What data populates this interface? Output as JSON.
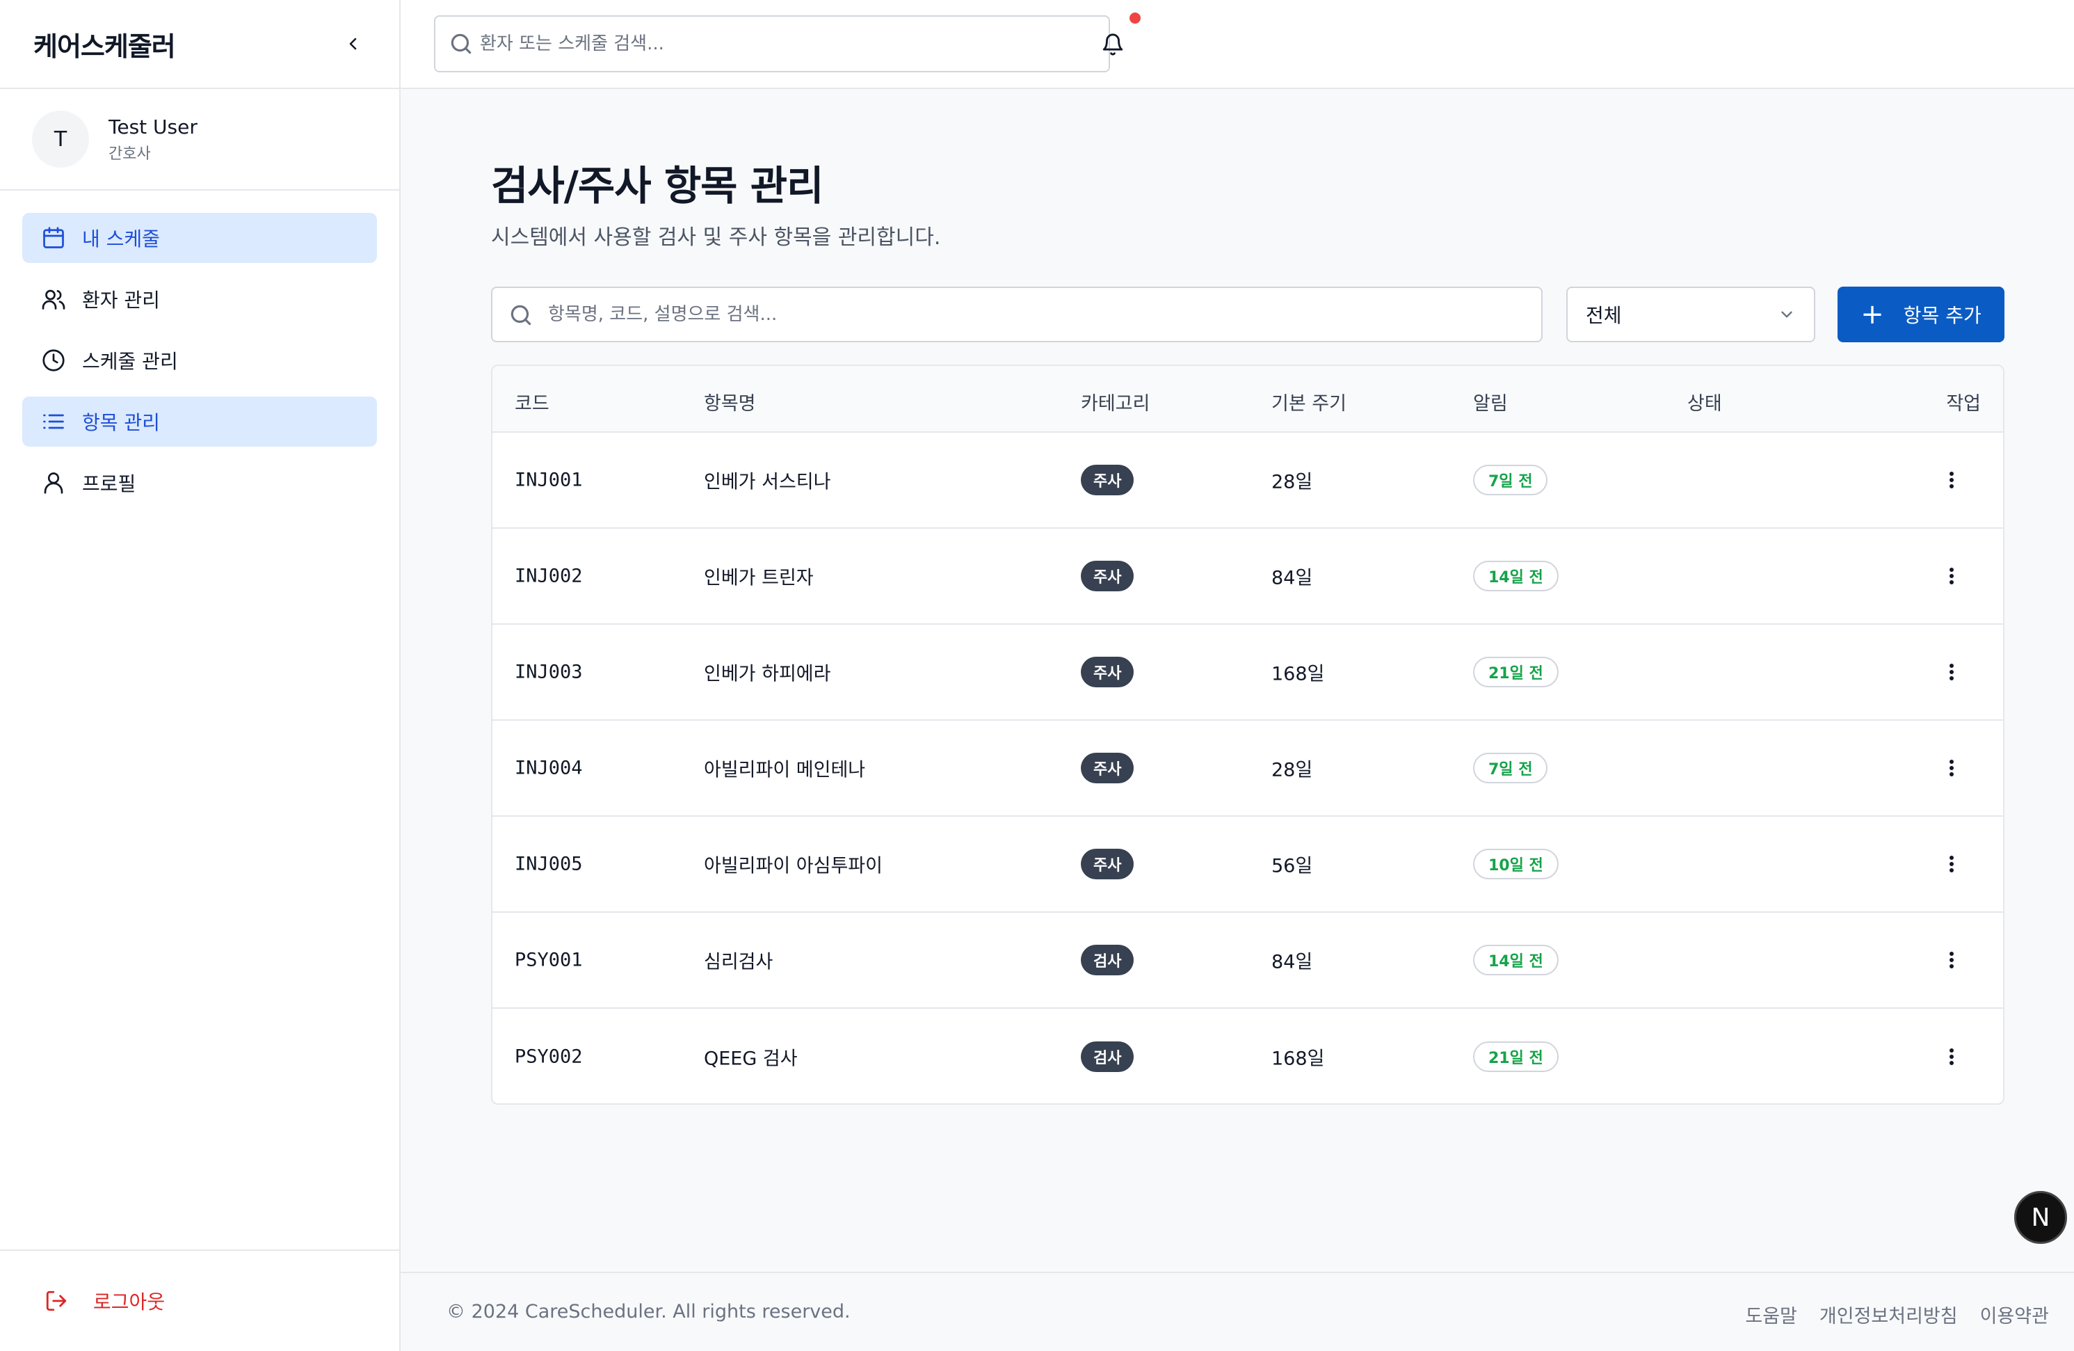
{
  "app": {
    "brand": "케어스케줄러"
  },
  "user": {
    "initial": "T",
    "name": "Test User",
    "role": "간호사"
  },
  "sidebar": {
    "items": [
      {
        "label": "내 스케줄",
        "icon": "calendar-icon",
        "active": true
      },
      {
        "label": "환자 관리",
        "icon": "users-icon",
        "active": false
      },
      {
        "label": "스케줄 관리",
        "icon": "clock-icon",
        "active": false
      },
      {
        "label": "항목 관리",
        "icon": "list-icon",
        "active": true
      },
      {
        "label": "프로필",
        "icon": "user-icon",
        "active": false
      }
    ],
    "logout_label": "로그아웃"
  },
  "topbar": {
    "search_placeholder": "환자 또는 스케줄 검색..."
  },
  "page": {
    "title": "검사/주사 항목 관리",
    "description": "시스템에서 사용할 검사 및 주사 항목을 관리합니다.",
    "search_placeholder": "항목명, 코드, 설명으로 검색...",
    "filter_value": "전체",
    "add_button": "항목 추가"
  },
  "table": {
    "headers": {
      "code": "코드",
      "name": "항목명",
      "category": "카테고리",
      "cycle": "기본 주기",
      "alert": "알림",
      "status": "상태",
      "action": "작업"
    },
    "rows": [
      {
        "code": "INJ001",
        "name": "인베가 서스티나",
        "category": "주사",
        "cycle": "28일",
        "alert": "7일 전",
        "enabled": true
      },
      {
        "code": "INJ002",
        "name": "인베가 트린자",
        "category": "주사",
        "cycle": "84일",
        "alert": "14일 전",
        "enabled": true
      },
      {
        "code": "INJ003",
        "name": "인베가 하피에라",
        "category": "주사",
        "cycle": "168일",
        "alert": "21일 전",
        "enabled": true
      },
      {
        "code": "INJ004",
        "name": "아빌리파이 메인테나",
        "category": "주사",
        "cycle": "28일",
        "alert": "7일 전",
        "enabled": true
      },
      {
        "code": "INJ005",
        "name": "아빌리파이 아심투파이",
        "category": "주사",
        "cycle": "56일",
        "alert": "10일 전",
        "enabled": true
      },
      {
        "code": "PSY001",
        "name": "심리검사",
        "category": "검사",
        "cycle": "84일",
        "alert": "14일 전",
        "enabled": true
      },
      {
        "code": "PSY002",
        "name": "QEEG 검사",
        "category": "검사",
        "cycle": "168일",
        "alert": "21일 전",
        "enabled": true
      }
    ]
  },
  "footer": {
    "copyright": "© 2024 CareScheduler. All rights reserved.",
    "links": [
      "도움말",
      "개인정보처리방침",
      "이용약관"
    ]
  },
  "dev_badge": "N",
  "colors": {
    "primary": "#0a5bc4",
    "active_nav_bg": "#dbeafe",
    "danger": "#dc2626",
    "alert_text": "#16a34a",
    "badge_dark": "#374151"
  }
}
